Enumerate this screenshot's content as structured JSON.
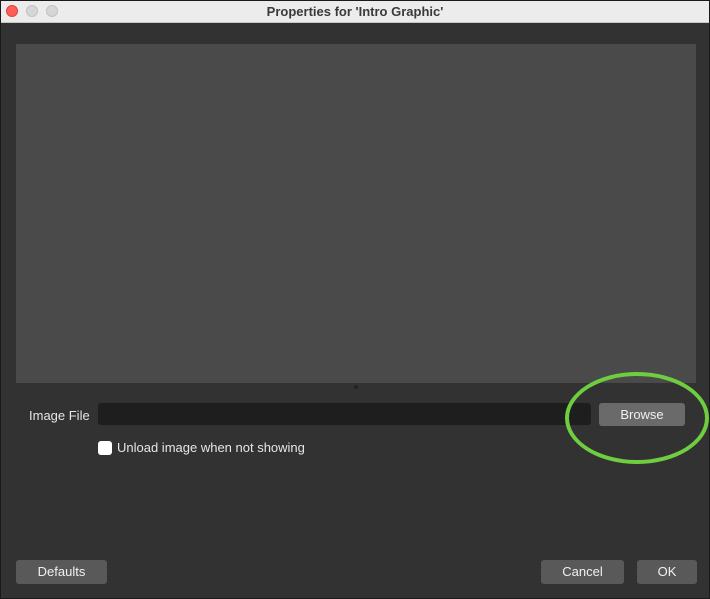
{
  "window": {
    "title": "Properties for 'Intro Graphic'"
  },
  "form": {
    "image_file_label": "Image File",
    "image_file_value": "",
    "browse_label": "Browse",
    "unload_checkbox_label": "Unload image when not showing",
    "unload_checked": false
  },
  "footer": {
    "defaults_label": "Defaults",
    "cancel_label": "Cancel",
    "ok_label": "OK"
  },
  "colors": {
    "highlight": "#6fce3f",
    "background": "#323232",
    "preview": "#4a4a4a"
  }
}
